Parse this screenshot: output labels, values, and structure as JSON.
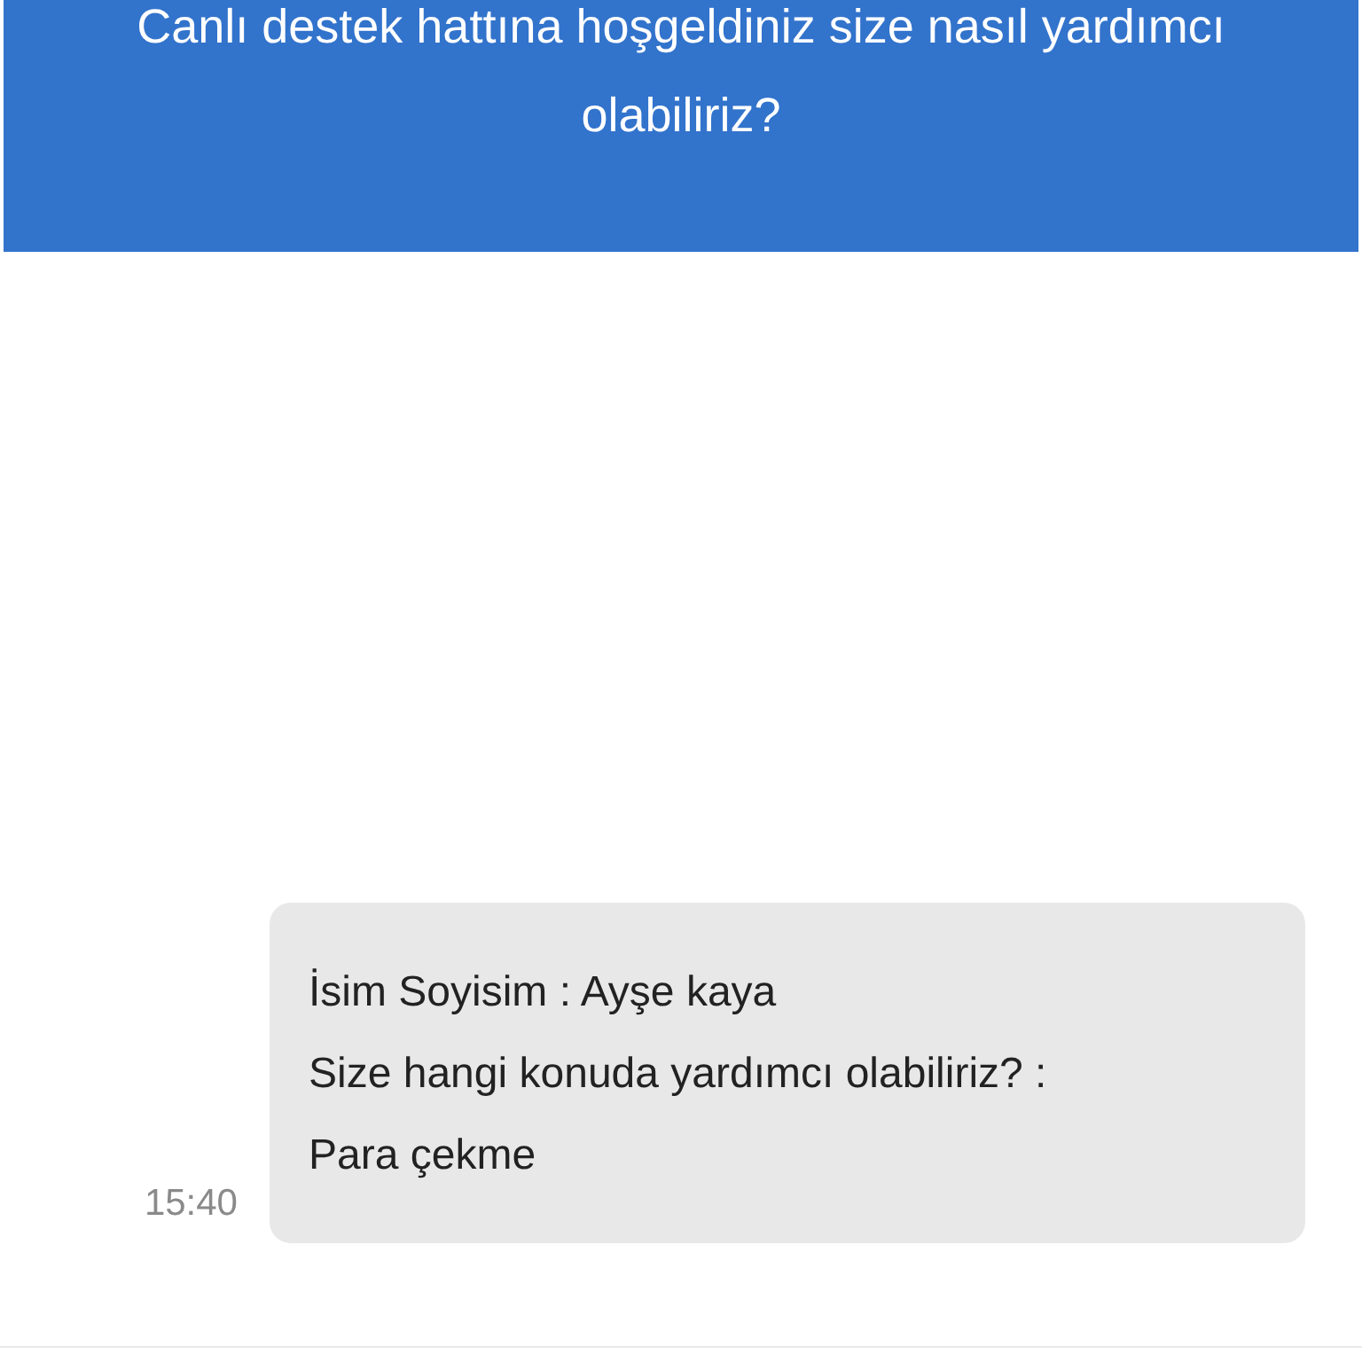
{
  "header": {
    "title": "Canlı destek hattına hoşgeldiniz size nasıl yardımcı olabiliriz?"
  },
  "messages": [
    {
      "time": "15:40",
      "lines": [
        "İsim Soyisim : Ayşe kaya",
        "Size hangi konuda yardımcı olabiliriz? :",
        "Para çekme"
      ]
    }
  ]
}
